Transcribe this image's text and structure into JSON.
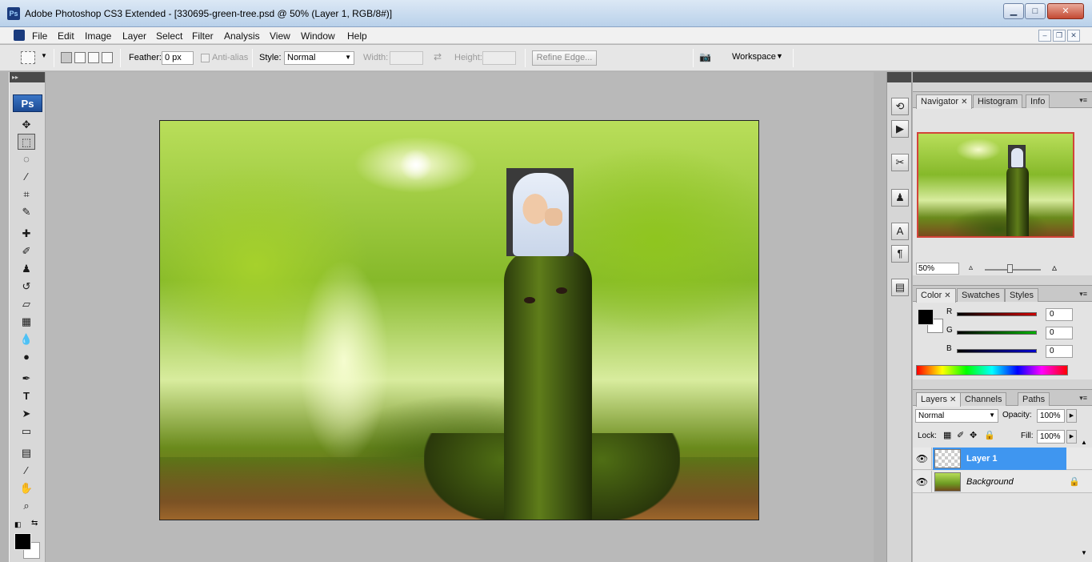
{
  "window": {
    "title": "Adobe Photoshop CS3 Extended - [330695-green-tree.psd @ 50% (Layer 1, RGB/8#)]",
    "app_icon": "Ps",
    "controls": {
      "minimize": "▁",
      "maximize": "□",
      "close": "✕"
    }
  },
  "menu": {
    "items": [
      "File",
      "Edit",
      "Image",
      "Layer",
      "Select",
      "Filter",
      "Analysis",
      "View",
      "Window",
      "Help"
    ],
    "doc_controls": {
      "minimize": "–",
      "restore": "❐",
      "close": "✕"
    }
  },
  "options": {
    "feather_label": "Feather:",
    "feather_value": "0 px",
    "antialias_label": "Anti-alias",
    "style_label": "Style:",
    "style_value": "Normal",
    "width_label": "Width:",
    "height_label": "Height:",
    "refine_edge": "Refine Edge...",
    "workspace": "Workspace"
  },
  "toolbox": {
    "logo": "Ps",
    "tools": [
      {
        "icon": "move-icon",
        "glyph": "✥"
      },
      {
        "icon": "rect-marquee-icon",
        "glyph": "⬚"
      },
      {
        "icon": "lasso-icon",
        "glyph": "◌"
      },
      {
        "icon": "magic-wand-icon",
        "glyph": "⁄"
      },
      {
        "icon": "crop-icon",
        "glyph": "⌗"
      },
      {
        "icon": "slice-icon",
        "glyph": "✎"
      },
      {
        "icon": "healing-brush-icon",
        "glyph": "✚"
      },
      {
        "icon": "brush-icon",
        "glyph": "✐"
      },
      {
        "icon": "clone-stamp-icon",
        "glyph": "♟"
      },
      {
        "icon": "history-brush-icon",
        "glyph": "↺"
      },
      {
        "icon": "eraser-icon",
        "glyph": "▱"
      },
      {
        "icon": "gradient-icon",
        "glyph": "▦"
      },
      {
        "icon": "blur-icon",
        "glyph": "💧"
      },
      {
        "icon": "dodge-icon",
        "glyph": "●"
      },
      {
        "icon": "pen-icon",
        "glyph": "✒"
      },
      {
        "icon": "type-icon",
        "glyph": "T"
      },
      {
        "icon": "path-selection-icon",
        "glyph": "➤"
      },
      {
        "icon": "rectangle-shape-icon",
        "glyph": "▭"
      },
      {
        "icon": "notes-icon",
        "glyph": "▤"
      },
      {
        "icon": "eyedropper-icon",
        "glyph": "⁄"
      },
      {
        "icon": "hand-icon",
        "glyph": "✋"
      },
      {
        "icon": "zoom-icon",
        "glyph": "⌕"
      }
    ]
  },
  "panels": {
    "navigator": {
      "tabs": [
        "Navigator",
        "Histogram",
        "Info"
      ],
      "zoom": "50%"
    },
    "color": {
      "tabs": [
        "Color",
        "Swatches",
        "Styles"
      ],
      "channels": [
        {
          "label": "R",
          "value": "0",
          "color": "#cc0000"
        },
        {
          "label": "G",
          "value": "0",
          "color": "#00b000"
        },
        {
          "label": "B",
          "value": "0",
          "color": "#0000cc"
        }
      ]
    },
    "layers": {
      "tabs": [
        "Layers",
        "Channels",
        "Paths"
      ],
      "blend_mode": "Normal",
      "opacity_label": "Opacity:",
      "opacity_value": "100%",
      "lock_label": "Lock:",
      "fill_label": "Fill:",
      "fill_value": "100%",
      "items": [
        {
          "name": "Layer 1",
          "selected": true
        },
        {
          "name": "Background",
          "selected": false,
          "locked": true
        }
      ]
    }
  }
}
